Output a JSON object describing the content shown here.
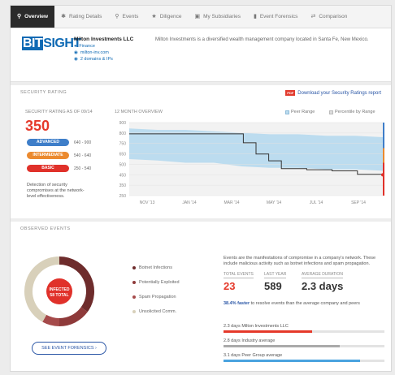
{
  "nav": [
    {
      "label": "Overview",
      "icon": "magnifier-icon",
      "active": true
    },
    {
      "label": "Rating Details",
      "icon": "settings-icon",
      "active": false
    },
    {
      "label": "Events",
      "icon": "pin-icon",
      "active": false
    },
    {
      "label": "Diligence",
      "icon": "star-icon",
      "active": false
    },
    {
      "label": "My Subsidiaries",
      "icon": "building-icon",
      "active": false
    },
    {
      "label": "Event Forensics",
      "icon": "bars-icon",
      "active": false
    },
    {
      "label": "Comparison",
      "icon": "compare-icon",
      "active": false
    }
  ],
  "company": {
    "logo_bit": "BIT",
    "logo_sight": "SIGHT",
    "name": "Milton Investments LLC",
    "industry": "Finance",
    "website": "milton-inv.com",
    "ip_link": "2 domains & IPs",
    "description": "Milton Investments is a diversified wealth management company located in Santa Fe, New Mexico."
  },
  "security": {
    "section_title": "SECURITY RATING",
    "download_badge": "PDF",
    "download_label": "Download your Security Ratings report",
    "rating_label": "SECURITY RATING AS OF 09/14",
    "rating_value": "350",
    "bands": [
      {
        "label": "ADVANCED",
        "range": "640 - 900",
        "color": "#3e7ec9"
      },
      {
        "label": "INTERMEDIATE",
        "range": "540 - 640",
        "color": "#eb8a2f"
      },
      {
        "label": "BASIC",
        "range": "250 - 540",
        "color": "#e0312a"
      }
    ],
    "rating_desc": "Detection of security compromises at the network-level effectiveness."
  },
  "chart_data": {
    "type": "line",
    "title": "12 MONTH OVERVIEW",
    "legend": [
      {
        "label": "Peer Range",
        "color": "#bcdcef"
      },
      {
        "label": "Percentile by Range",
        "color": "#dddddd"
      }
    ],
    "y_ticks": [
      "900",
      "800",
      "750",
      "650",
      "500",
      "450",
      "350",
      "250"
    ],
    "x_ticks": [
      "NOV '13",
      "JAN '14",
      "MAR '14",
      "MAY '14",
      "JUL '14",
      "SEP '14"
    ],
    "ylim": [
      250,
      900
    ],
    "series": [
      {
        "x": [
          0,
          0.38,
          0.45,
          0.5,
          0.55,
          0.6,
          0.7,
          0.8,
          0.9,
          1.0
        ],
        "values": [
          800,
          800,
          720,
          620,
          560,
          490,
          480,
          470,
          440,
          435
        ]
      }
    ]
  },
  "events": {
    "section_title": "OBSERVED EVENTS",
    "donut_center": "INFECTED",
    "donut_sub": "58 TOTAL",
    "donut_segments": [
      {
        "value": 35,
        "color": "#6e2c2c"
      },
      {
        "value": 15,
        "color": "#8e3a3a"
      },
      {
        "value": 8,
        "color": "#a54a4a"
      },
      {
        "value": 42,
        "color": "#d8d0ba"
      }
    ],
    "legend": [
      {
        "label": "Botnet Infections",
        "color": "#6e2c2c"
      },
      {
        "label": "Potentially Exploited",
        "color": "#8e3a3a"
      },
      {
        "label": "Spam Propagation",
        "color": "#a54a4a"
      },
      {
        "label": "Unsolicited Comm.",
        "color": "#d8d0ba"
      }
    ],
    "button_label": "SEE EVENT FORENSICS",
    "intro": "Events are the manifestations of compromise in a company's network. These include malicious activity such as botnet infections and spam propagation.",
    "stats": [
      {
        "label": "TOTAL EVENTS",
        "value": "23",
        "color": "#e5392a"
      },
      {
        "label": "LAST YEAR",
        "value": "589",
        "color": "#222"
      },
      {
        "label": "AVERAGE DURATION",
        "value": "2.3 days",
        "color": "#222"
      }
    ],
    "note_highlight": "38.4% faster",
    "note_text": "to resolve events than the average company and peers",
    "bars": [
      {
        "label": "2.3 days Milton Investments LLC",
        "fill": 0.55,
        "color": "#e5392a"
      },
      {
        "label": "2.8 days Industry average",
        "fill": 0.72,
        "color": "#aaaaaa"
      },
      {
        "label": "3.1 days Peer Group average",
        "fill": 0.85,
        "color": "#4aa3df"
      }
    ]
  }
}
